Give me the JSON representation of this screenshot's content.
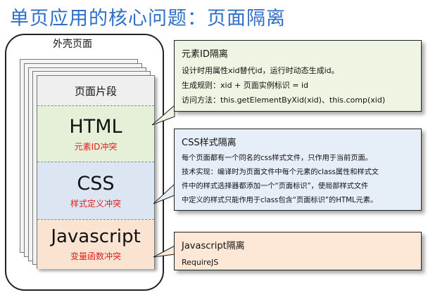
{
  "title": "单页应用的核心问题：页面隔离",
  "outer_label": "外壳页面",
  "fragment": {
    "label": "页面片段",
    "sections": [
      {
        "name": "HTML",
        "conflict": "元素ID冲突"
      },
      {
        "name": "CSS",
        "conflict": "样式定义冲突"
      },
      {
        "name": "Javascript",
        "conflict": "变量函数冲突"
      }
    ]
  },
  "callouts": {
    "html": {
      "heading": "元素ID隔离",
      "lines": [
        "设计时用属性xid替代id，运行时动态生成id。",
        "生成规则：xid + 页面实例标识 = id",
        "访问方法：this.getElementByXid(xid)、this.comp(xid)"
      ]
    },
    "css": {
      "heading": "CSS样式隔离",
      "lines": [
        "每个页面都有一个同名的css样式文件，只作用于当前页面。",
        "技术实现：编译时为页面文件中每个元素的class属性和样式文",
        "件中的样式选择器都添加一个“页面标识”，使局部样式文件",
        "中定义的样式只能作用于class包含“页面标识”的HTML元素。"
      ]
    },
    "js": {
      "heading": "Javascript隔离",
      "lines": [
        "RequireJS"
      ]
    }
  },
  "colors": {
    "title": "#2f6fc8",
    "html_fill": "#e6efd8",
    "css_fill": "#dce6f2",
    "js_fill": "#fbe3d2",
    "conflict_text": "#e02020"
  }
}
